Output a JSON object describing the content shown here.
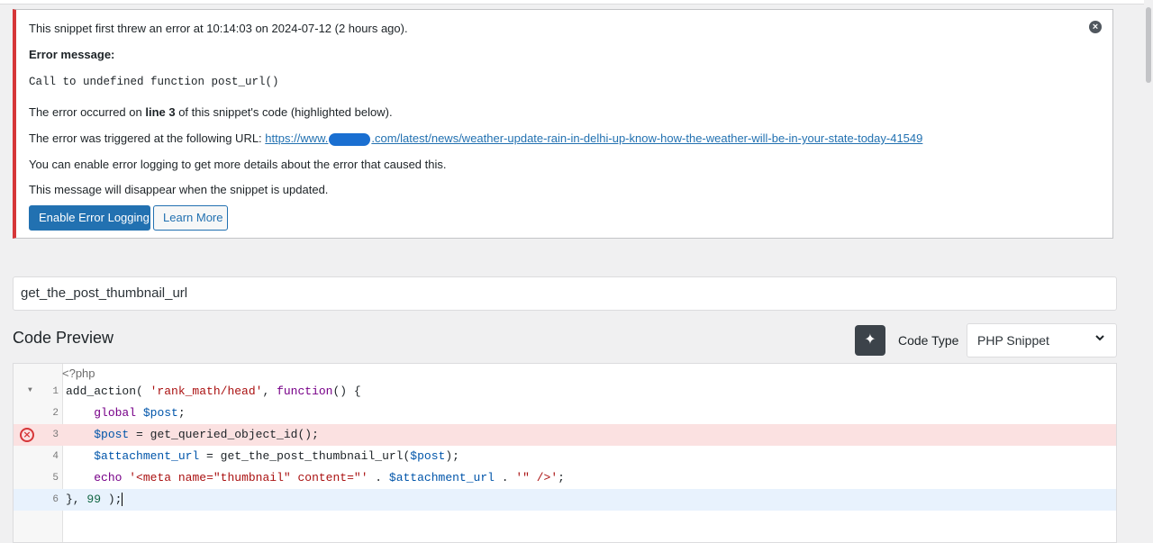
{
  "notice": {
    "intro": "This snippet first threw an error at 10:14:03 on 2024-07-12 (2 hours ago).",
    "error_label": "Error message:",
    "error_text": "Call to undefined function post_url()",
    "occurred_prefix": "The error occurred on ",
    "occurred_line": "line 3",
    "occurred_suffix": " of this snippet's code (highlighted below).",
    "url_prefix": "The error was triggered at the following URL: ",
    "url_start": "https://www.",
    "url_end": ".com/latest/news/weather-update-rain-in-delhi-up-know-how-the-weather-will-be-in-your-state-today-41549",
    "logging_hint": "You can enable error logging to get more details about the error that caused this.",
    "disappear_hint": "This message will disappear when the snippet is updated.",
    "enable_button": "Enable Error Logging",
    "learn_button": "Learn More",
    "dismiss_icon": "close-circle-icon"
  },
  "snippet": {
    "title": "get_the_post_thumbnail_url"
  },
  "preview": {
    "title": "Code Preview",
    "ai_icon": "sparkle-icon",
    "code_type_label": "Code Type",
    "code_type_value": "PHP Snippet"
  },
  "code": {
    "opening_tag": "<?php",
    "line_numbers": [
      "1",
      "2",
      "3",
      "4",
      "5",
      "6"
    ],
    "l1": {
      "fn": "add_action( ",
      "s1": "'rank_math/head'",
      "comma": ", ",
      "kw": "function",
      "rest": "() {"
    },
    "l2": {
      "kw": "global",
      "sp": " ",
      "var": "$post",
      "end": ";"
    },
    "l3": {
      "var": "$post",
      "rest": " = get_queried_object_id();"
    },
    "l4": {
      "var1": "$attachment_url",
      "mid": " = get_the_post_thumbnail_url(",
      "var2": "$post",
      "end": ");"
    },
    "l5": {
      "kw": "echo",
      "sp": " ",
      "s1": "'<meta name=\"thumbnail\" content=\"'",
      "dot1": " . ",
      "var": "$attachment_url",
      "dot2": " . ",
      "s2": "'\" />'",
      "end": ";"
    },
    "l6": {
      "open": "}, ",
      "num": "99",
      "close": " );"
    }
  },
  "colors": {
    "accent": "#2271b1",
    "error": "#d63638",
    "error_line_bg": "#fbe1e1",
    "active_line_bg": "#e8f2fd"
  }
}
